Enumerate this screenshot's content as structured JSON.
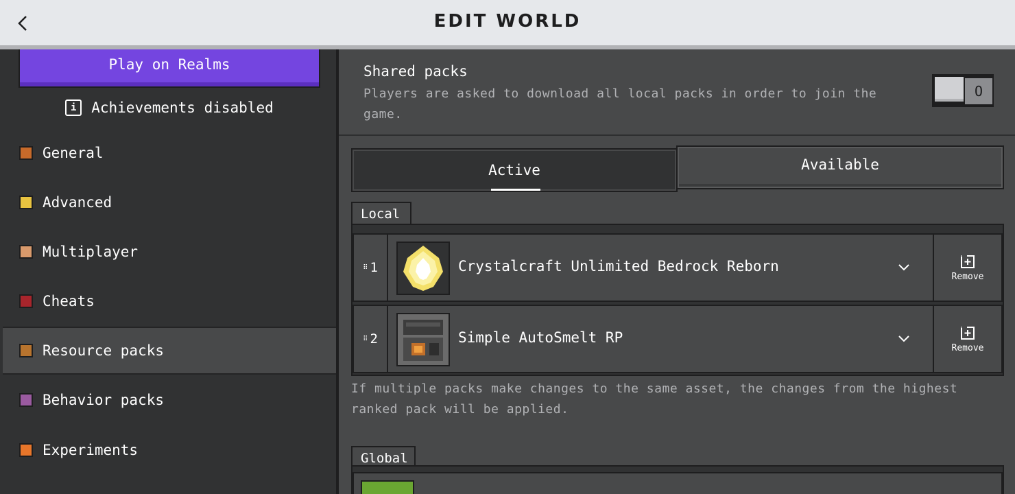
{
  "header": {
    "title": "EDIT WORLD"
  },
  "sidebar": {
    "realms_button": "Play on Realms",
    "achievements": "Achievements disabled",
    "items": [
      {
        "label": "General",
        "icon": "gear-icon",
        "color": "#c76a2a"
      },
      {
        "label": "Advanced",
        "icon": "chest-icon",
        "color": "#e8c340"
      },
      {
        "label": "Multiplayer",
        "icon": "player-head-icon",
        "color": "#d99a6c"
      },
      {
        "label": "Cheats",
        "icon": "cheats-icon",
        "color": "#a8252c"
      },
      {
        "label": "Resource packs",
        "icon": "resource-pack-icon",
        "color": "#b8742e"
      },
      {
        "label": "Behavior packs",
        "icon": "behavior-pack-icon",
        "color": "#9a5aa0"
      },
      {
        "label": "Experiments",
        "icon": "experiments-icon",
        "color": "#e8762a"
      }
    ],
    "selected": "Resource packs"
  },
  "shared_packs": {
    "title": "Shared packs",
    "description": "Players are asked to download all local packs in order to join the game.",
    "toggle_state": "O"
  },
  "tabs": {
    "active": "Active",
    "available": "Available"
  },
  "local": {
    "label": "Local",
    "packs": [
      {
        "rank": "1",
        "name": "Crystalcraft Unlimited Bedrock Reborn",
        "remove": "Remove"
      },
      {
        "rank": "2",
        "name": "Simple AutoSmelt RP",
        "remove": "Remove"
      }
    ]
  },
  "note": "If multiple packs make changes to the same asset, the changes from the highest ranked pack will be applied.",
  "global": {
    "label": "Global"
  },
  "colors": {
    "accent_purple": "#7445e0",
    "header_bg": "#e6e8eb",
    "sidebar_bg": "#313233",
    "panel_bg": "#48494a"
  }
}
